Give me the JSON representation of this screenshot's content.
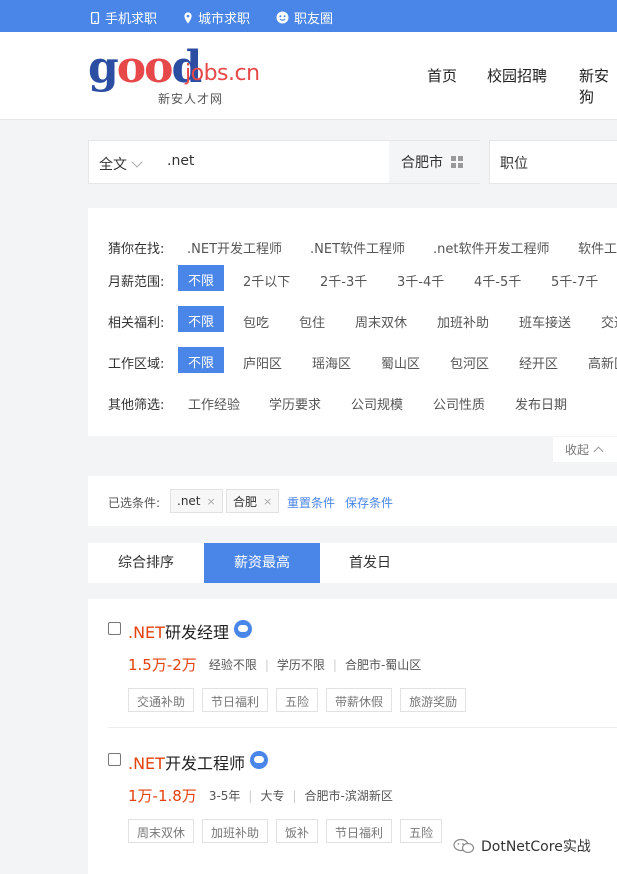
{
  "topbar": {
    "items": [
      {
        "label": "手机求职",
        "icon": "phone-icon"
      },
      {
        "label": "城市求职",
        "icon": "location-pin-icon"
      },
      {
        "label": "职友圈",
        "icon": "smiley-icon"
      }
    ]
  },
  "logo": {
    "text_good": "good",
    "text_domain": "jobs.cn",
    "subtitle": "新安人才网"
  },
  "nav": [
    "首页",
    "校园招聘",
    "新安狗"
  ],
  "search": {
    "scope": "全文",
    "keyword": ".net",
    "city": "合肥市",
    "position": "职位"
  },
  "filters": {
    "guess": {
      "label": "猜你在找:",
      "options": [
        ".NET开发工程师",
        ".NET软件工程师",
        ".net软件开发工程师",
        "软件工"
      ]
    },
    "salary": {
      "label": "月薪范围:",
      "options": [
        "不限",
        "2千以下",
        "2千-3千",
        "3千-4千",
        "4千-5千",
        "5千-7千"
      ]
    },
    "welfare": {
      "label": "相关福利:",
      "options": [
        "不限",
        "包吃",
        "包住",
        "周末双休",
        "加班补助",
        "班车接送",
        "交通"
      ]
    },
    "area": {
      "label": "工作区域:",
      "options": [
        "不限",
        "庐阳区",
        "瑶海区",
        "蜀山区",
        "包河区",
        "经开区",
        "高新区"
      ]
    },
    "other": {
      "label": "其他筛选:",
      "options": [
        "工作经验",
        "学历要求",
        "公司规模",
        "公司性质",
        "发布日期"
      ]
    },
    "collapse": "收起"
  },
  "selected": {
    "label": "已选条件:",
    "chips": [
      ".net",
      "合肥"
    ],
    "chip_close": "×",
    "reset": "重置条件",
    "save": "保存条件"
  },
  "sort": {
    "tabs": [
      "综合排序",
      "薪资最高",
      "首发日"
    ],
    "active": 1
  },
  "jobs": [
    {
      "title_highlight": ".NET",
      "title_rest": "研发经理",
      "salary": "1.5万-2万",
      "experience": "经验不限",
      "education": "学历不限",
      "location": "合肥市-蜀山区",
      "tags": [
        "交通补助",
        "节日福利",
        "五险",
        "带薪休假",
        "旅游奖励"
      ]
    },
    {
      "title_highlight": ".NET",
      "title_rest": "开发工程师",
      "salary": "1万-1.8万",
      "experience": "3-5年",
      "education": "大专",
      "location": "合肥市-滨湖新区",
      "tags": [
        "周末双休",
        "加班补助",
        "饭补",
        "节日福利",
        "五险"
      ]
    }
  ],
  "watermark": "DotNetCore实战",
  "colors": {
    "accent": "#4a86e8",
    "salary": "#e3410d",
    "logo_red": "#e7484a",
    "logo_blue": "#2c4ea2"
  }
}
